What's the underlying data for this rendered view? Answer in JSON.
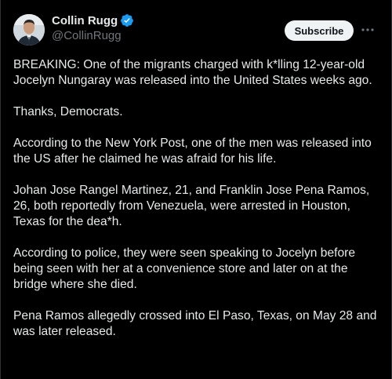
{
  "author": {
    "display_name": "Collin Rugg",
    "handle": "@CollinRugg",
    "avatar_icon": "person-avatar",
    "verified_icon": "verified-badge-icon",
    "verified_color": "#1d9bf0"
  },
  "actions": {
    "subscribe_label": "Subscribe",
    "more_icon": "more-icon"
  },
  "tweet": {
    "paragraphs": [
      "BREAKING: One of the migrants charged with k*lling 12-year-old Jocelyn Nungaray was released into the United States weeks ago.",
      "Thanks, Democrats.",
      "According to the New York Post, one of the men was released into the US after he claimed he was afraid for his life.",
      "Johan Jose Rangel Martinez, 21, and Franklin Jose Pena Ramos, 26, both reportedly from Venezuela, were arrested in Houston, Texas for the dea*h.",
      "According to police, they were seen speaking to Jocelyn before being seen with her at a convenience store and later on at the bridge where she died.",
      "Pena Ramos allegedly crossed into El Paso, Texas, on May 28 and was later released."
    ]
  },
  "colors": {
    "background": "#000000",
    "text_primary": "#e7e9ea",
    "text_secondary": "#71767b",
    "button_bg": "#eff3f4"
  }
}
